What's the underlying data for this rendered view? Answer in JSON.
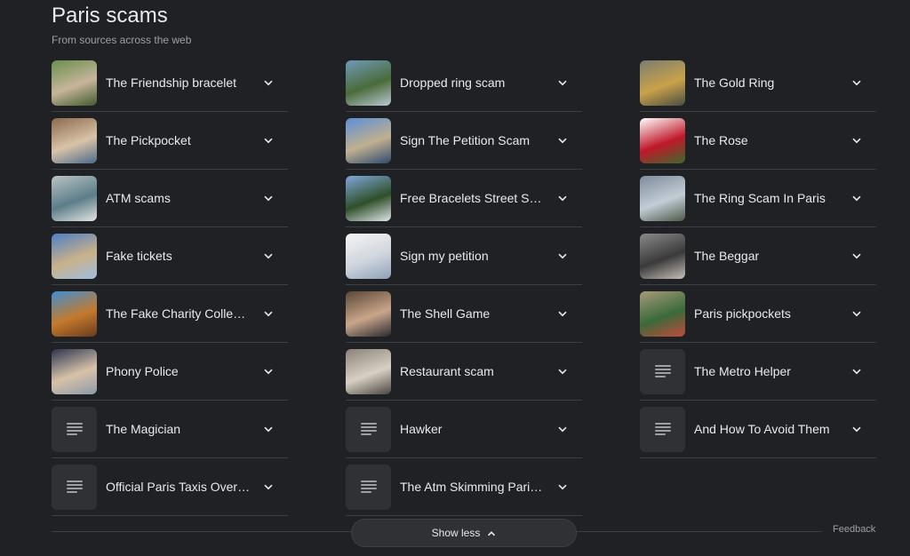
{
  "header": {
    "title": "Paris scams",
    "subtitle": "From sources across the web"
  },
  "columns": [
    {
      "items": [
        {
          "label": "The Friendship bracelet",
          "thumb": "photo",
          "icon": "friendship-bracelet-photo",
          "colors": [
            "#6a8f4f",
            "#c7b59a",
            "#3e5a2c"
          ]
        },
        {
          "label": "The Pickpocket",
          "thumb": "photo",
          "icon": "pickpocket-photo",
          "colors": [
            "#8a6a4c",
            "#d9c3a8",
            "#4c6a8a"
          ]
        },
        {
          "label": "ATM scams",
          "thumb": "photo",
          "icon": "atm-scam-photo",
          "colors": [
            "#b9c4c2",
            "#5c7d8a",
            "#e4e6e2"
          ]
        },
        {
          "label": "Fake tickets",
          "thumb": "photo",
          "icon": "arc-de-triomphe-photo",
          "colors": [
            "#4f7ec4",
            "#c9b28a",
            "#9fbde0"
          ]
        },
        {
          "label": "The Fake Charity Collector",
          "thumb": "photo",
          "icon": "charity-collector-photo",
          "colors": [
            "#3f8fd1",
            "#c47a2c",
            "#6b3a1f"
          ]
        },
        {
          "label": "Phony Police",
          "thumb": "photo",
          "icon": "police-officer-photo",
          "colors": [
            "#2b3550",
            "#d8c2a8",
            "#8c9aa8"
          ]
        },
        {
          "label": "The Magician",
          "thumb": "doc",
          "icon": "article-icon"
        },
        {
          "label": "Official Paris Taxis Overc...",
          "thumb": "doc",
          "icon": "article-icon"
        }
      ]
    },
    {
      "items": [
        {
          "label": "Dropped ring scam",
          "thumb": "photo",
          "icon": "seine-river-photo",
          "colors": [
            "#6f9ab8",
            "#4a6b3a",
            "#b8c8d4"
          ]
        },
        {
          "label": "Sign The Petition Scam",
          "thumb": "photo",
          "icon": "paris-street-photo",
          "colors": [
            "#5c8fd6",
            "#c0b090",
            "#2e4a6e"
          ]
        },
        {
          "label": "Free Bracelets Street Sell...",
          "thumb": "photo",
          "icon": "montmartre-photo",
          "colors": [
            "#7fa8d8",
            "#2f4f2a",
            "#e0e6ea"
          ]
        },
        {
          "label": "Sign my petition",
          "thumb": "photo",
          "icon": "petition-form-photo",
          "colors": [
            "#f4f4f4",
            "#d0d6de",
            "#8ea0b8"
          ]
        },
        {
          "label": "The Shell Game",
          "thumb": "photo",
          "icon": "shell-game-photo",
          "colors": [
            "#5a4636",
            "#c9a68a",
            "#2a2a30"
          ]
        },
        {
          "label": "Restaurant scam",
          "thumb": "photo",
          "icon": "restaurant-photo",
          "colors": [
            "#8a8276",
            "#d8d0c4",
            "#4a463e"
          ]
        },
        {
          "label": "Hawker",
          "thumb": "doc",
          "icon": "article-icon"
        },
        {
          "label": "The Atm Skimming Paris ...",
          "thumb": "doc",
          "icon": "article-icon"
        }
      ]
    },
    {
      "items": [
        {
          "label": "The Gold Ring",
          "thumb": "photo",
          "icon": "gold-ring-photo",
          "colors": [
            "#7b7d70",
            "#c9a24a",
            "#4a4c42"
          ]
        },
        {
          "label": "The Rose",
          "thumb": "photo",
          "icon": "red-rose-photo",
          "colors": [
            "#ffffff",
            "#c0182a",
            "#3d6a2c"
          ]
        },
        {
          "label": "The Ring Scam In Paris",
          "thumb": "photo",
          "icon": "eiffel-tower-photo",
          "colors": [
            "#7e8c9c",
            "#c4ccd6",
            "#4a5a48"
          ]
        },
        {
          "label": "The Beggar",
          "thumb": "photo",
          "icon": "street-crowd-photo",
          "colors": [
            "#8a8a8a",
            "#3a3a3a",
            "#c8c0b8"
          ]
        },
        {
          "label": "Paris pickpockets",
          "thumb": "photo",
          "icon": "metro-station-photo",
          "colors": [
            "#a89a7a",
            "#3a6a3a",
            "#c44a3a"
          ]
        },
        {
          "label": "The Metro Helper",
          "thumb": "doc",
          "icon": "article-icon"
        },
        {
          "label": "And How To Avoid Them",
          "thumb": "doc",
          "icon": "article-icon"
        }
      ]
    }
  ],
  "footer": {
    "show_less_label": "Show less",
    "feedback_label": "Feedback"
  },
  "theme": {
    "background": "#202124",
    "divider": "#3c4043",
    "text": "#e8eaed",
    "muted_text": "#9aa0a6"
  }
}
